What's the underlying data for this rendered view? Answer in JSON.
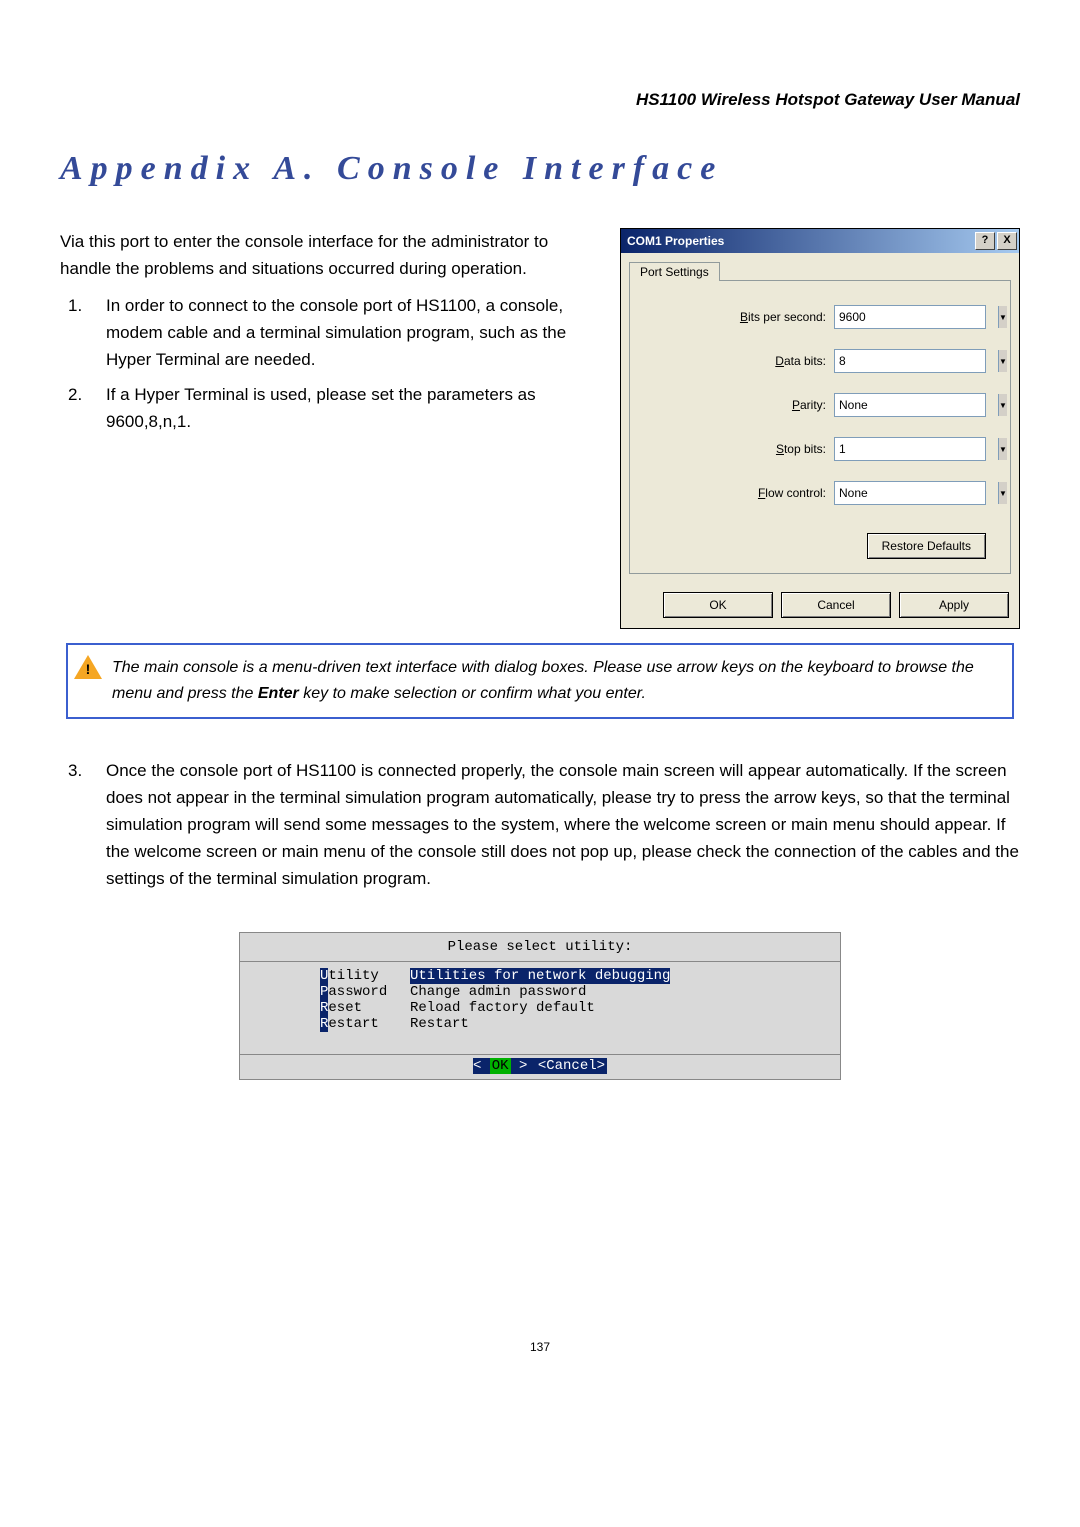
{
  "doc_header": "HS1100 Wireless Hotspot Gateway User Manual",
  "title": "Appendix A.   Console Interface",
  "intro": "Via this port to enter the console interface for the administrator to handle the problems and situations occurred during operation.",
  "items": {
    "n1": "1.",
    "n2": "2.",
    "n3": "3.",
    "t1": "In order to connect to the console port of HS1100, a console, modem cable and a terminal simulation program, such as the Hyper Terminal are needed.",
    "t2": "If a Hyper Terminal is used, please set the parameters as 9600,8,n,1.",
    "t3": "Once the console port of HS1100 is connected properly, the console main screen will appear automatically. If the screen does not appear in the terminal simulation program automatically, please try to press the arrow keys, so that the terminal simulation program will send some messages to the system, where the welcome screen or main menu should appear. If the welcome screen or main menu of the console still does not pop up, please check the connection of the cables and the settings of the terminal simulation program."
  },
  "note": {
    "pre": "The main console is a menu-driven text interface with dialog boxes. Please use arrow keys on the keyboard to browse the menu and press the ",
    "bold": "Enter",
    "post": " key to make selection or confirm what you enter."
  },
  "dialog": {
    "title": "COM1 Properties",
    "tab": "Port Settings",
    "fields": {
      "bps": {
        "label": "Bits per second:",
        "underline": "B",
        "value": "9600"
      },
      "data": {
        "label": "Data bits:",
        "underline": "D",
        "value": "8"
      },
      "parity": {
        "label": "Parity:",
        "underline": "P",
        "value": "None"
      },
      "stop": {
        "label": "Stop bits:",
        "underline": "S",
        "value": "1"
      },
      "flow": {
        "label": "Flow control:",
        "underline": "F",
        "value": "None"
      }
    },
    "buttons": {
      "restore": "Restore Defaults",
      "ok": "OK",
      "cancel": "Cancel",
      "apply": "Apply",
      "help": "?",
      "close": "X"
    }
  },
  "terminal": {
    "header": "Please select utility:",
    "menu": [
      {
        "hot": "U",
        "opt": "tility ",
        "desc": "Utilities for network debugging",
        "selected": true
      },
      {
        "hot": "P",
        "opt": "assword",
        "desc": "Change admin password",
        "selected": false
      },
      {
        "hot": "R",
        "opt": "eset   ",
        "desc": "Reload factory default",
        "selected": false
      },
      {
        "hot": "R",
        "opt": "estart ",
        "desc": "Restart",
        "selected": false
      }
    ],
    "foot": {
      "lt": "< ",
      "ok": "OK",
      "mid": " >        ",
      "cancel": "<Cancel>"
    }
  },
  "page_number": "137"
}
